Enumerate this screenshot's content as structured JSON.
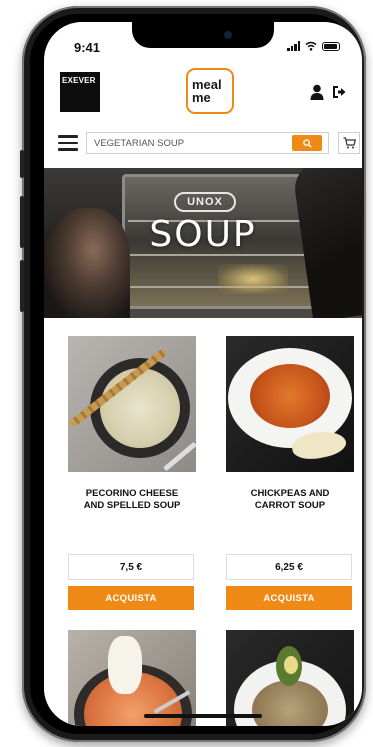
{
  "status_bar": {
    "time": "9:41"
  },
  "header": {
    "exever_logo": "EXEVER",
    "mealme_logo_line1": "meal",
    "mealme_logo_line2": "me"
  },
  "search": {
    "value": "VEGETARIAN SOUP",
    "placeholder": ""
  },
  "hero": {
    "badge": "UNOX",
    "title": "SOUP"
  },
  "products": [
    {
      "name": "PECORINO CHEESE\nAND SPELLED SOUP",
      "price": "7,5 €",
      "buy_label": "ACQUISTA"
    },
    {
      "name": "CHICKPEAS AND\nCARROT SOUP",
      "price": "6,25 €",
      "buy_label": "ACQUISTA"
    },
    {
      "name": "",
      "price": "",
      "buy_label": ""
    },
    {
      "name": "",
      "price": "",
      "buy_label": ""
    }
  ],
  "colors": {
    "accent": "#ef8a17",
    "dark": "#111111"
  },
  "icons": [
    "user-icon",
    "logout-icon",
    "menu-icon",
    "search-icon",
    "cart-icon"
  ]
}
